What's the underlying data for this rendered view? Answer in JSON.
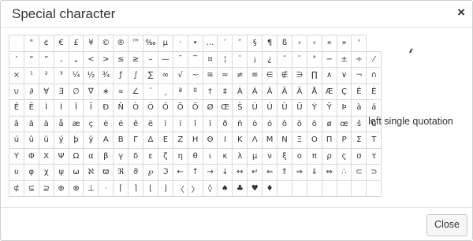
{
  "dialog": {
    "title": "Special character",
    "close_icon": "×",
    "close_button_label": "Close"
  },
  "preview": {
    "glyph": "‘",
    "name": "left single quotation"
  },
  "grid": [
    [
      "",
      "\"",
      "¢",
      "€",
      "£",
      "¥",
      "©",
      "®",
      "™",
      "‰",
      "µ",
      "·",
      "•",
      "…",
      "′",
      "″",
      "§",
      "¶",
      "ß",
      "‹",
      "›",
      "«",
      "»",
      "‘"
    ],
    [
      "’",
      "“",
      "”",
      "‚",
      "„",
      "<",
      ">",
      "≤",
      "≥",
      "–",
      "—",
      "¯",
      "‾",
      "¤",
      "¦",
      "¨",
      "¡",
      "¿",
      "ˆ",
      "˜",
      "°",
      "−",
      "±",
      "÷",
      "⁄"
    ],
    [
      "×",
      "¹",
      "²",
      "³",
      "¼",
      "½",
      "¾",
      "ƒ",
      "∫",
      "∑",
      "∞",
      "√",
      "∼",
      "≅",
      "≈",
      "≠",
      "≡",
      "∈",
      "∉",
      "∋",
      "∏",
      "∧",
      "∨",
      "¬",
      "∩"
    ],
    [
      "∪",
      "∂",
      "∀",
      "∃",
      "∅",
      "∇",
      "∗",
      "∝",
      "∠",
      "´",
      "¸",
      "ª",
      "º",
      "†",
      "‡",
      "À",
      "Á",
      "Â",
      "Ã",
      "Ä",
      "Å",
      "Æ",
      "Ç",
      "È",
      "É"
    ],
    [
      "Ê",
      "Ë",
      "Ì",
      "Í",
      "Î",
      "Ï",
      "Ð",
      "Ñ",
      "Ò",
      "Ó",
      "Ô",
      "Õ",
      "Ö",
      "Ø",
      "Œ",
      "Š",
      "Ù",
      "Ú",
      "Û",
      "Ü",
      "Ý",
      "Ÿ",
      "Þ",
      "à",
      "á"
    ],
    [
      "â",
      "ã",
      "ä",
      "å",
      "æ",
      "ç",
      "è",
      "é",
      "ê",
      "ë",
      "ì",
      "í",
      "î",
      "ï",
      "ð",
      "ñ",
      "ò",
      "ó",
      "ô",
      "õ",
      "ö",
      "ø",
      "œ",
      "š",
      "ù"
    ],
    [
      "ú",
      "û",
      "ü",
      "ý",
      "þ",
      "ÿ",
      "Α",
      "Β",
      "Γ",
      "Δ",
      "Ε",
      "Ζ",
      "Η",
      "Θ",
      "Ι",
      "Κ",
      "Λ",
      "Μ",
      "Ν",
      "Ξ",
      "Ο",
      "Π",
      "Ρ",
      "Σ",
      "Τ"
    ],
    [
      "Υ",
      "Φ",
      "Χ",
      "Ψ",
      "Ω",
      "α",
      "β",
      "γ",
      "δ",
      "ε",
      "ζ",
      "η",
      "θ",
      "ι",
      "κ",
      "λ",
      "μ",
      "ν",
      "ξ",
      "ο",
      "π",
      "ρ",
      "ς",
      "σ",
      "τ"
    ],
    [
      "υ",
      "φ",
      "χ",
      "ψ",
      "ω",
      "ℵ",
      "ϖ",
      "ℜ",
      "ϑ",
      "℘",
      "ℑ",
      "←",
      "↑",
      "→",
      "↓",
      "↔",
      "↵",
      "⇐",
      "⇑",
      "⇒",
      "⇓",
      "⇔",
      "∴",
      "⊂",
      "⊃"
    ],
    [
      "⊄",
      "⊆",
      "⊇",
      "⊕",
      "⊗",
      "⊥",
      "⋅",
      "⌈",
      "⌉",
      "⌊",
      "⌋",
      "〈",
      "〉",
      "◊",
      "♠",
      "♣",
      "♥",
      "♦",
      "",
      "",
      "",
      "",
      "",
      "",
      ""
    ]
  ]
}
